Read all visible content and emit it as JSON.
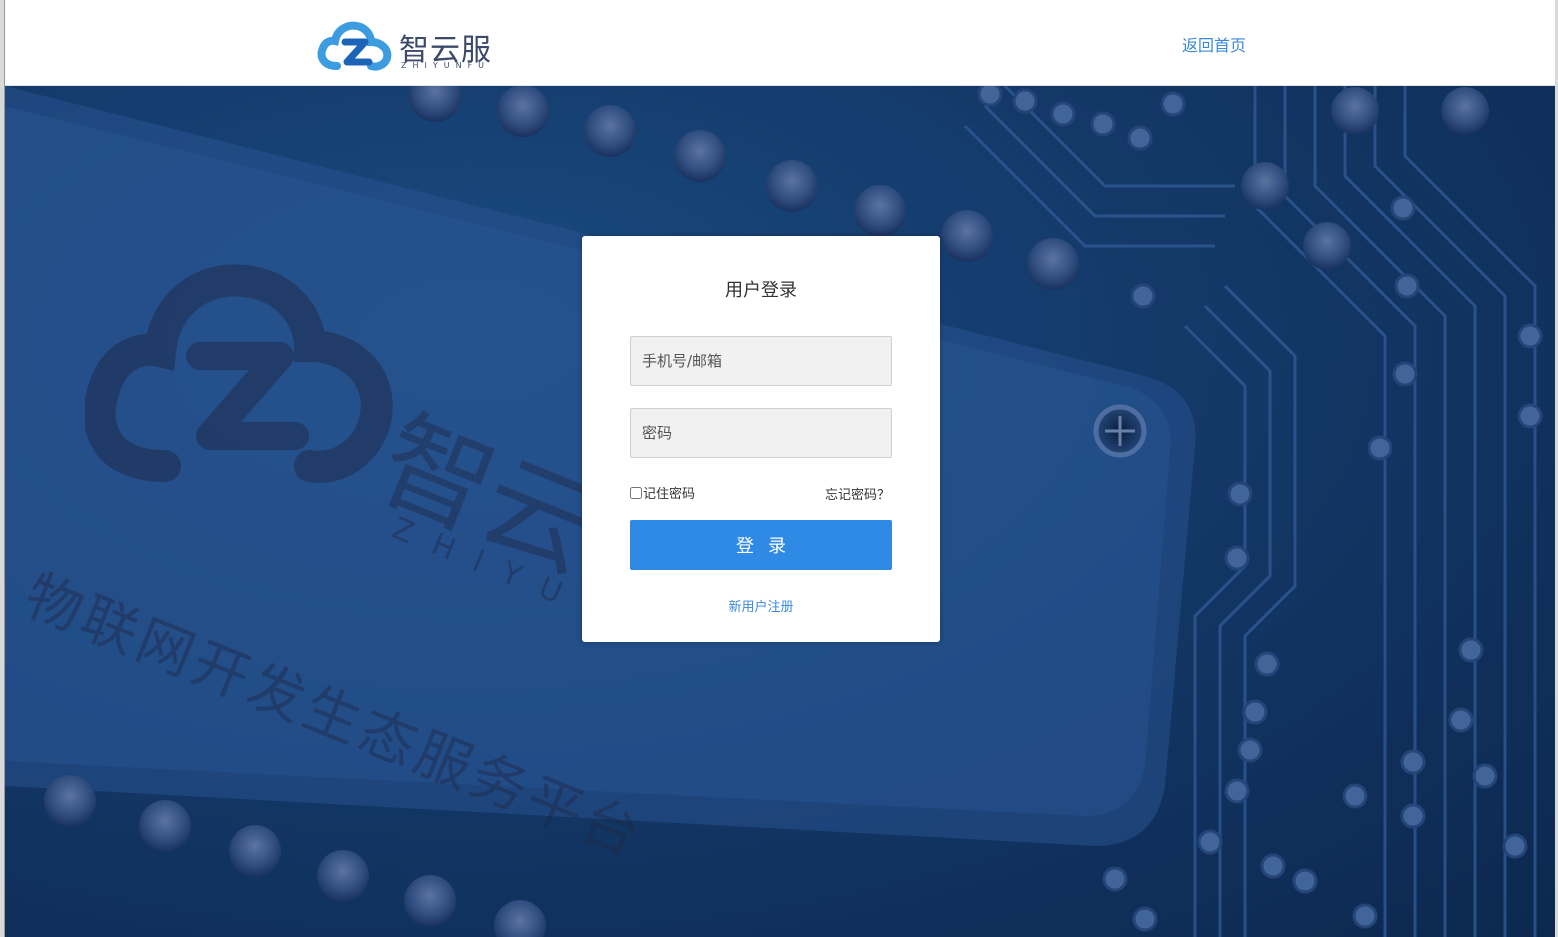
{
  "header": {
    "logo_cn": "智云服",
    "logo_en": "ZHIYUNFU",
    "home_link": "返回首页"
  },
  "background": {
    "watermark_cn": "智云",
    "watermark_en": "ZHIYU",
    "slogan": "物联网开发生态服务平台"
  },
  "login": {
    "title": "用户登录",
    "account_placeholder": "手机号/邮箱",
    "password_placeholder": "密码",
    "remember_label": "记住密码",
    "forgot_label": "忘记密码？",
    "submit_label": "登录",
    "register_label": "新用户注册"
  },
  "colors": {
    "accent": "#2f8ae5",
    "link": "#3a8ad8",
    "hero_bg": "#163f72"
  }
}
